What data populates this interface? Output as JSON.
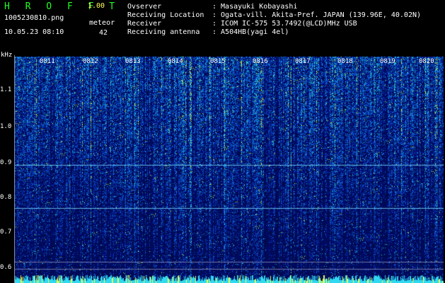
{
  "header": {
    "app_logo": "H R O F F T",
    "version": "1.00",
    "file_name": "1005230810.png",
    "datetime": "10.05.23 08:10",
    "meteor_label": "meteor",
    "meteor_count": "42",
    "observer_label": "Ovserver",
    "observer_value": ": Masayuki Kobayashi",
    "location_label": "Receiving Location",
    "location_value": ": Ogata-vill. Akita-Pref. JAPAN (139.96E, 40.02N)",
    "receiver_label": "Receiver",
    "receiver_value": ": ICOM IC-575 53.7492(@LCD)MHz USB",
    "antenna_label": "Receiving antenna",
    "antenna_value": ": A504HB(yagi 4el)"
  },
  "plot": {
    "y_unit": "kHz",
    "y_ticks": [
      "1.1",
      "1.0",
      "0.9",
      "0.8",
      "0.7",
      "0.6"
    ],
    "x_ticks": [
      "0811",
      "0812",
      "0813",
      "0814",
      "0815",
      "0816",
      "0817",
      "0818",
      "0819",
      "0820"
    ]
  },
  "colors": {
    "background": "#000000",
    "spectrogram_base": "#02083a",
    "logo": "#22ff22",
    "version": "#ffff55"
  }
}
